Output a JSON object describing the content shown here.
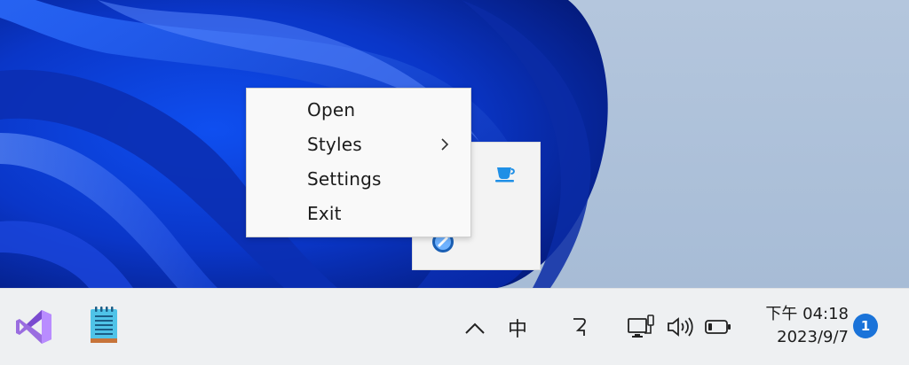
{
  "context_menu": {
    "items": [
      {
        "label": "Open"
      },
      {
        "label": "Styles",
        "has_submenu": true
      },
      {
        "label": "Settings"
      },
      {
        "label": "Exit"
      }
    ]
  },
  "tray_flyout": {
    "icons": [
      "coffee-cup-icon",
      "blue-round-icon"
    ]
  },
  "taskbar": {
    "apps": [
      "visual-studio-icon",
      "notepad-icon"
    ],
    "tray": {
      "show_hidden_icons": "^",
      "ime_label": "中",
      "ime_mode_icon": "input-mode-icon",
      "network_icon": "network-icon",
      "volume_icon": "volume-icon",
      "battery_icon": "battery-icon"
    },
    "clock": {
      "time": "下午 04:18",
      "date": "2023/9/7"
    },
    "notifications": {
      "count": "1"
    }
  },
  "colors": {
    "wallpaper_blue": "#0a3fd1",
    "accent": "#1a73d9",
    "taskbar": "#eef0f2",
    "menu_bg": "#f9f9f9"
  }
}
